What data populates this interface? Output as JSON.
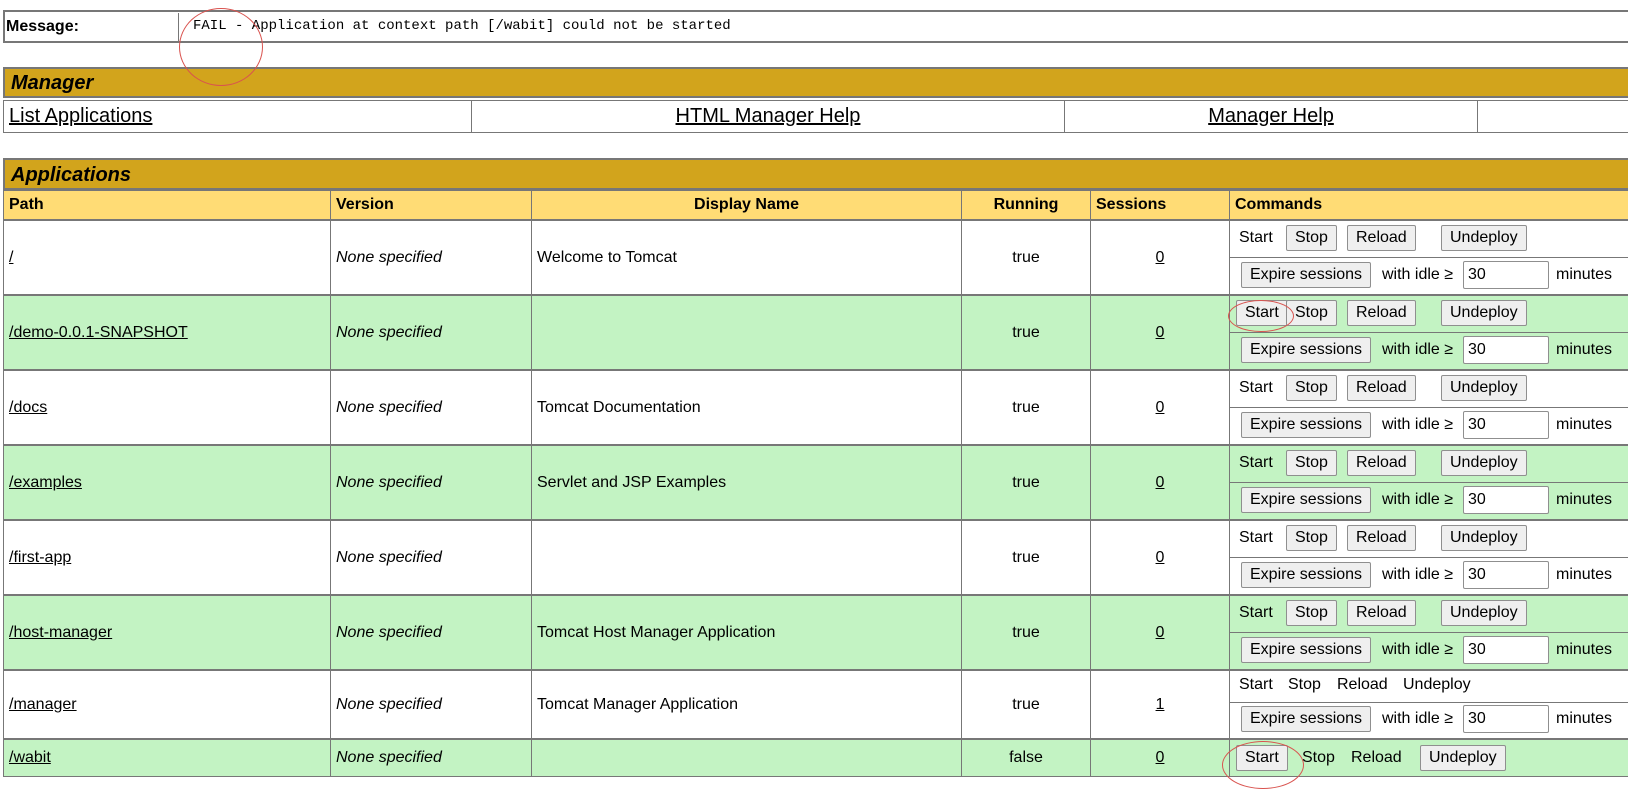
{
  "message": {
    "label": "Message:",
    "text": "FAIL - Application at context path [/wabit] could not be started"
  },
  "manager": {
    "title": "Manager",
    "links": [
      "List Applications",
      "HTML Manager Help",
      "Manager Help"
    ]
  },
  "applications": {
    "title": "Applications",
    "columns": [
      "Path",
      "Version",
      "Display Name",
      "Running",
      "Sessions",
      "Commands"
    ],
    "rows": [
      {
        "path": "/",
        "version": "None specified",
        "display_name": "Welcome to Tomcat",
        "running": "true",
        "sessions": "0"
      },
      {
        "path": "/demo-0.0.1-SNAPSHOT",
        "version": "None specified",
        "display_name": "",
        "running": "true",
        "sessions": "0"
      },
      {
        "path": "/docs",
        "version": "None specified",
        "display_name": "Tomcat Documentation",
        "running": "true",
        "sessions": "0"
      },
      {
        "path": "/examples",
        "version": "None specified",
        "display_name": "Servlet and JSP Examples",
        "running": "true",
        "sessions": "0"
      },
      {
        "path": "/first-app",
        "version": "None specified",
        "display_name": "",
        "running": "true",
        "sessions": "0"
      },
      {
        "path": "/host-manager",
        "version": "None specified",
        "display_name": "Tomcat Host Manager Application",
        "running": "true",
        "sessions": "0"
      },
      {
        "path": "/manager",
        "version": "None specified",
        "display_name": "Tomcat Manager Application",
        "running": "true",
        "sessions": "1"
      },
      {
        "path": "/wabit",
        "version": "None specified",
        "display_name": "",
        "running": "false",
        "sessions": "0"
      }
    ]
  },
  "commands": {
    "start": "Start",
    "stop": "Stop",
    "reload": "Reload",
    "undeploy": "Undeploy",
    "expire_sessions": "Expire sessions",
    "with_idle": "with idle ≥",
    "idle_value": "30",
    "minutes": "minutes"
  },
  "colors": {
    "header_bar": "#D2A41C",
    "column_header": "#FFDC75",
    "row_green": "#C3F3C3",
    "annotation": "#d9534f"
  }
}
